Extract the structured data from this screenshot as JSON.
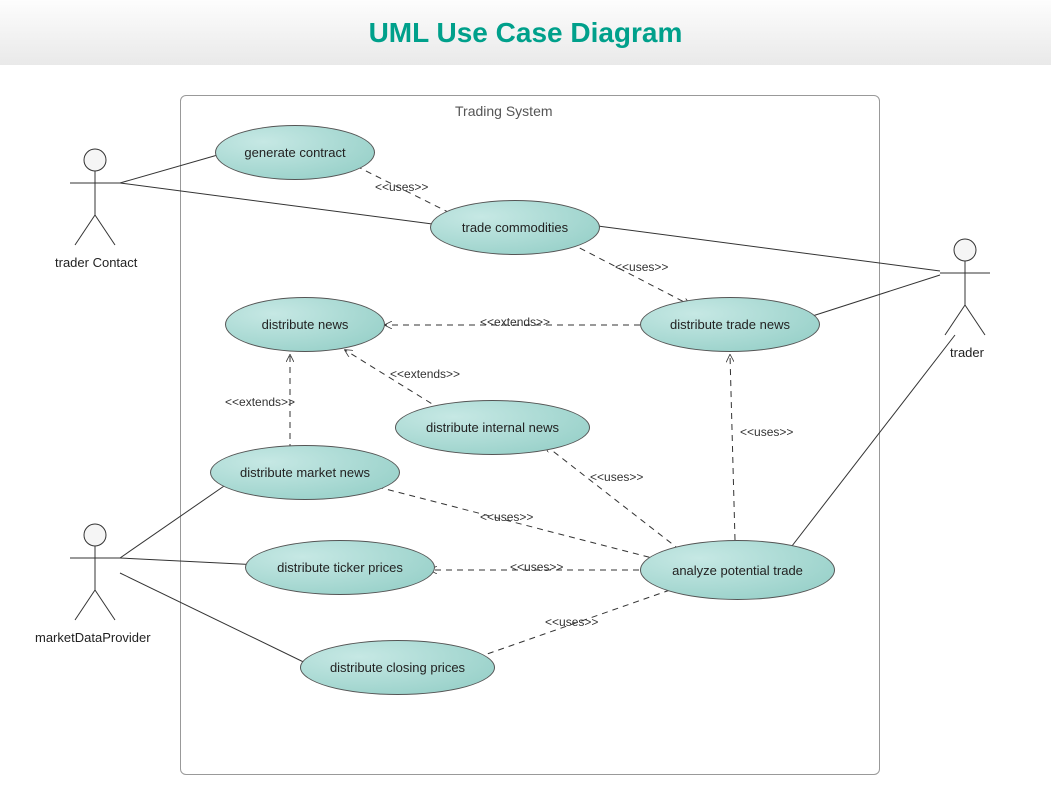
{
  "title": "UML Use Case Diagram",
  "system": {
    "label": "Trading System"
  },
  "actors": {
    "traderContact": "trader Contact",
    "marketDataProvider": "marketDataProvider",
    "trader": "trader"
  },
  "usecases": {
    "generateContract": "generate contract",
    "tradeCommodities": "trade commodities",
    "distributeNews": "distribute news",
    "distributeTradeNews": "distribute trade news",
    "distributeInternalNews": "distribute internal news",
    "distributeMarketNews": "distribute market news",
    "distributeTickerPrices": "distribute ticker prices",
    "analyzePotentialTrade": "analyze potential trade",
    "distributeClosingPrices": "distribute closing prices"
  },
  "relLabels": {
    "uses1": "<<uses>>",
    "uses2": "<<uses>>",
    "extends1": "<<extends>>",
    "extends2": "<<extends>>",
    "extends3": "<<extends>>",
    "uses3": "<<uses>>",
    "uses4": "<<uses>>",
    "uses5": "<<uses>>",
    "uses6": "<<uses>>",
    "uses7": "<<uses>>"
  }
}
